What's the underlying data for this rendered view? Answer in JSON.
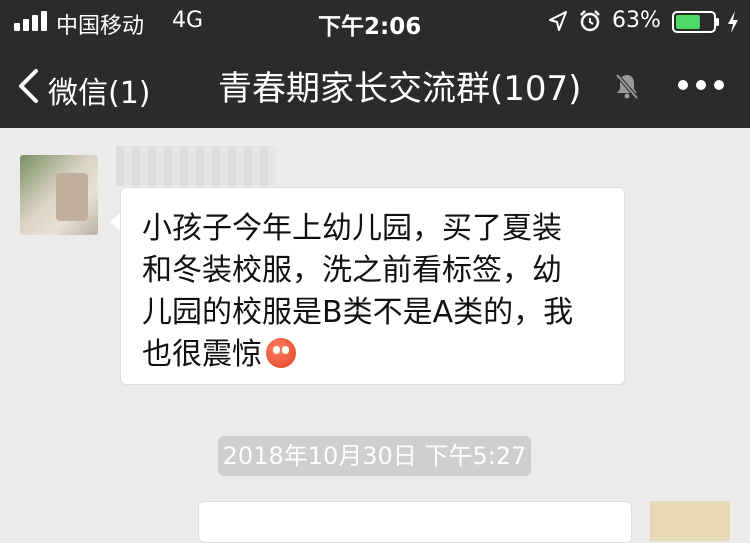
{
  "status_bar": {
    "carrier": "中国移动",
    "network": "4G",
    "time": "下午2:06",
    "battery_percent": "63%",
    "battery_level": 0.63,
    "icons": [
      "signal-icon",
      "location-icon",
      "alarm-icon",
      "battery-icon",
      "charging-icon"
    ]
  },
  "nav": {
    "back_label": "微信(1)",
    "title": "青春期家长交流群(107)",
    "icons": [
      "back-chevron-icon",
      "mute-icon",
      "more-icon"
    ]
  },
  "chat": {
    "message": {
      "lines": [
        "小孩子今年上幼儿园，买了夏装",
        "和冬装校服，洗之前看标签，幼",
        "儿园的校服是B类不是A类的，我",
        "也很震惊"
      ],
      "emoji": "flushed-face-emoji"
    },
    "timestamp": "2018年10月30日 下午5:27"
  },
  "colors": {
    "bar_bg": "#2b2b2b",
    "chat_bg": "#ebebeb",
    "bubble_bg": "#ffffff",
    "battery_green": "#4cd964",
    "timestamp_bg": "#cecece"
  }
}
